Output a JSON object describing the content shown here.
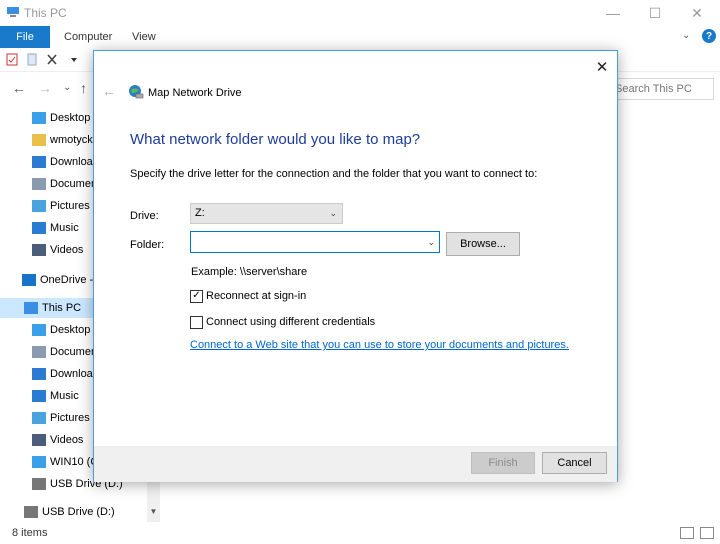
{
  "window": {
    "title": "This PC",
    "minimize_glyph": "—",
    "maximize_glyph": "☐",
    "close_glyph": "✕"
  },
  "ribbon": {
    "tabs": [
      "File",
      "Computer",
      "View"
    ],
    "collapse_glyph": "⌄",
    "help_glyph": "?"
  },
  "navbar": {
    "back_glyph": "←",
    "forward_glyph": "→",
    "recent_glyph": "⌄",
    "up_glyph": "↑",
    "search_placeholder": "Search This PC"
  },
  "sidebar": {
    "items": [
      {
        "label": "Desktop",
        "icon": "desktop-icon"
      },
      {
        "label": "wmotycka",
        "icon": "folder-icon"
      },
      {
        "label": "Downloac",
        "icon": "downloads-icon"
      },
      {
        "label": "Documen",
        "icon": "documents-icon"
      },
      {
        "label": "Pictures",
        "icon": "pictures-icon"
      },
      {
        "label": "Music",
        "icon": "music-icon"
      },
      {
        "label": "Videos",
        "icon": "videos-icon"
      },
      {
        "label": "OneDrive -",
        "icon": "onedrive-icon"
      },
      {
        "label": "This PC",
        "icon": "this-pc-icon"
      },
      {
        "label": "Desktop",
        "icon": "desktop-icon"
      },
      {
        "label": "Documen",
        "icon": "documents-icon"
      },
      {
        "label": "Downloac",
        "icon": "downloads-icon"
      },
      {
        "label": "Music",
        "icon": "music-icon"
      },
      {
        "label": "Pictures",
        "icon": "pictures-icon"
      },
      {
        "label": "Videos",
        "icon": "videos-icon"
      },
      {
        "label": "WIN10 (C",
        "icon": "windows-drive-icon"
      },
      {
        "label": "USB Drive (D:)",
        "icon": "usb-drive-icon"
      },
      {
        "label": "USB Drive (D:)",
        "icon": "usb-drive-icon"
      }
    ]
  },
  "status": {
    "item_count": "8 items"
  },
  "dialog": {
    "title": "Map Network Drive",
    "close_glyph": "✕",
    "back_glyph": "←",
    "heading": "What network folder would you like to map?",
    "description": "Specify the drive letter for the connection and the folder that you want to connect to:",
    "drive_label": "Drive:",
    "drive_value": "Z:",
    "folder_label": "Folder:",
    "folder_value": "",
    "browse_label": "Browse...",
    "example_text": "Example: \\\\server\\share",
    "reconnect_label": "Reconnect at sign-in",
    "reconnect_checked": true,
    "credentials_label": "Connect using different credentials",
    "credentials_checked": false,
    "web_link": "Connect to a Web site that you can use to store your documents and pictures.",
    "finish_label": "Finish",
    "cancel_label": "Cancel",
    "check_glyph": "✓",
    "dropdown_glyph": "⌄"
  },
  "colors": {
    "accent": "#1979ca",
    "heading": "#1f3d99",
    "link": "#0066cc",
    "selected_row": "#cce8ff"
  }
}
